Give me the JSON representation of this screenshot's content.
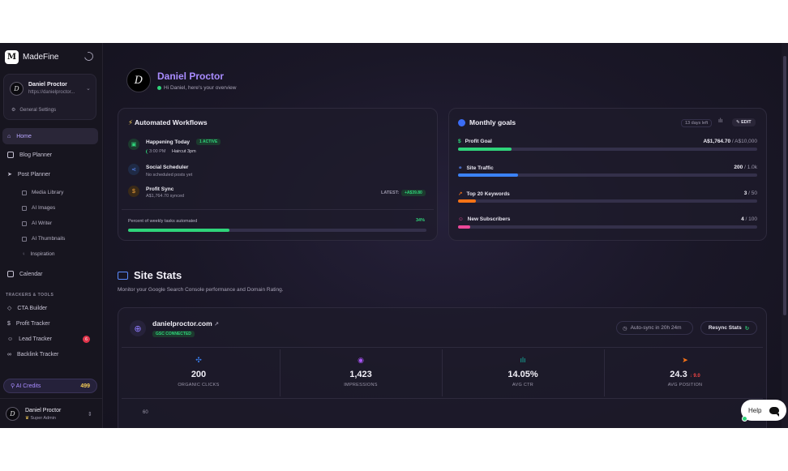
{
  "sidebar": {
    "logo_mark": "M",
    "app_name": "MadeFine",
    "profile": {
      "initial": "D",
      "name": "Daniel Proctor",
      "url": "https://danielproctor...",
      "settings_label": "General Settings"
    },
    "nav": {
      "home": "Home",
      "blog_planner": "Blog Planner",
      "post_planner": "Post Planner",
      "media_library": "Media Library",
      "ai_images": "AI Images",
      "ai_writer": "AI Writer",
      "ai_thumbnails": "AI Thumbnails",
      "inspiration": "Inspiration",
      "calendar": "Calendar"
    },
    "section_label": "TRACKERS & TOOLS",
    "tools": {
      "cta_builder": "CTA Builder",
      "profit_tracker": "Profit Tracker",
      "lead_tracker": "Lead Tracker",
      "lead_badge": "6",
      "backlink_tracker": "Backlink Tracker"
    },
    "credits": {
      "label": "AI Credits",
      "count": "499"
    },
    "footer": {
      "initial": "D",
      "name": "Daniel Proctor",
      "role": "Super Admin"
    }
  },
  "header": {
    "initial": "D",
    "name": "Daniel Proctor",
    "greeting": "Hi Daniel, here's your overview"
  },
  "workflows": {
    "title": "Automated Workflows",
    "items": [
      {
        "title": "Happening Today",
        "badge": "1 ACTIVE",
        "time": "3:00 PM",
        "sub": "Haircut 3pm"
      },
      {
        "title": "Social Scheduler",
        "sub": "No scheduled posts yet"
      },
      {
        "title": "Profit Sync",
        "sub": "A$1,764.70 synced",
        "latest_label": "LATEST:",
        "latest_value": "+A$39.80"
      }
    ],
    "weekly_label": "Percent of weekly tasks automated",
    "weekly_pct": "34%",
    "weekly_fraction": 0.34
  },
  "goals": {
    "title": "Monthly goals",
    "days_left": "13 days left",
    "edit_label": "EDIT",
    "items": [
      {
        "label": "Profit Goal",
        "current": "A$1,764.70",
        "target": "/ A$10,000",
        "fraction": 0.18,
        "color": "#2fd47a"
      },
      {
        "label": "Site Traffic",
        "current": "200",
        "target": "/ 1.0k",
        "fraction": 0.2,
        "color": "#3b82f6"
      },
      {
        "label": "Top 20 Keywords",
        "current": "3",
        "target": "/ 50",
        "fraction": 0.06,
        "color": "#f97316"
      },
      {
        "label": "New Subscribers",
        "current": "4",
        "target": "/ 100",
        "fraction": 0.04,
        "color": "#ec4899"
      }
    ]
  },
  "site_stats": {
    "title": "Site Stats",
    "subtitle": "Monitor your Google Search Console performance and Domain Rating.",
    "domain": "danielproctor.com",
    "gsc_badge": "GSC CONNECTED",
    "autosync": "Auto-sync in 20h 24m",
    "resync_label": "Resync Stats",
    "metrics": [
      {
        "value": "200",
        "label": "ORGANIC CLICKS",
        "color": "#3b82f6"
      },
      {
        "value": "1,423",
        "label": "IMPRESSIONS",
        "color": "#a855f7"
      },
      {
        "value": "14.05%",
        "label": "AVG CTR",
        "color": "#14b8a6"
      },
      {
        "value": "24.3",
        "delta": "↓ 9.0",
        "label": "AVG POSITION",
        "color": "#f97316"
      }
    ],
    "chart_tick": "60"
  },
  "help": {
    "label": "Help"
  }
}
